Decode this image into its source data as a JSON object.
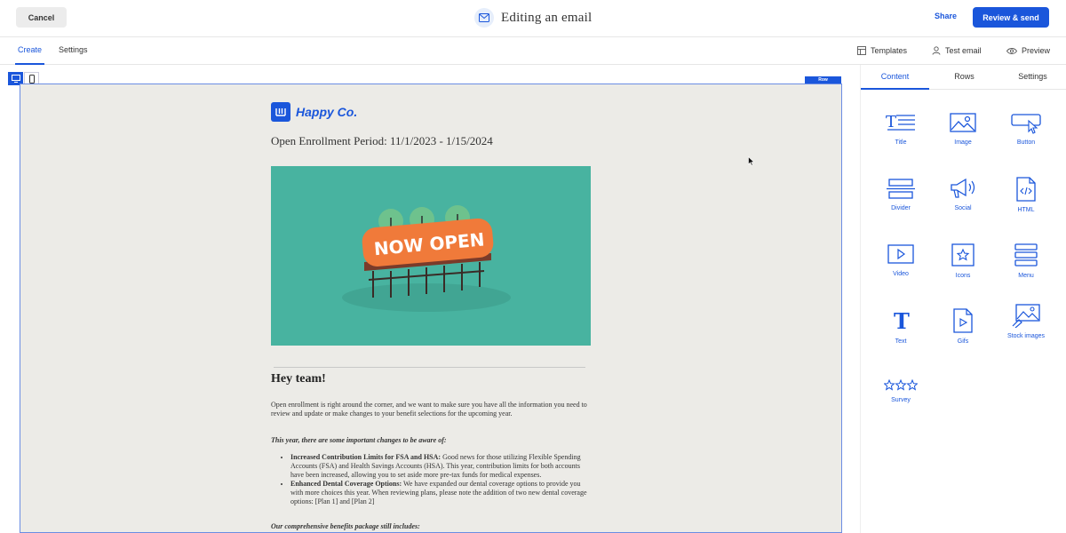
{
  "header": {
    "cancel_label": "Cancel",
    "title": "Editing an email",
    "share_label": "Share",
    "review_label": "Review & send"
  },
  "subbar": {
    "tabs": [
      {
        "label": "Create",
        "active": true
      },
      {
        "label": "Settings",
        "active": false
      }
    ],
    "tools": {
      "templates": "Templates",
      "test_email": "Test email",
      "preview": "Preview"
    }
  },
  "canvas": {
    "row_tag": "Row"
  },
  "email": {
    "logo_text": "Happy Co.",
    "enrollment_title": "Open Enrollment Period: 11/1/2023 - 1/15/2024",
    "hero_sign_text": "NOW OPEN",
    "greeting": "Hey team!",
    "intro": "Open enrollment is right around the corner, and we want to make sure you have all the information you need to review and update or make changes to your benefit selections for the upcoming year.",
    "changes_heading": "This year, there are some important changes to be aware of:",
    "changes": [
      {
        "title": "Increased Contribution Limits for FSA and HSA:",
        "text": " Good news for those utilizing Flexible Spending Accounts (FSA) and Health Savings Accounts (HSA). This year, contribution limits for both accounts have been increased, allowing you to set aside more pre-tax funds for medical expenses."
      },
      {
        "title": "Enhanced Dental Coverage Options:",
        "text": " We have expanded our dental coverage options to provide you with more choices this year. When reviewing plans, please note the addition of two new dental coverage options: [Plan 1] and [Plan 2]"
      }
    ],
    "package_heading": "Our comprehensive benefits package still includes:"
  },
  "panel": {
    "tabs": [
      {
        "label": "Content",
        "active": true
      },
      {
        "label": "Rows",
        "active": false
      },
      {
        "label": "Settings",
        "active": false
      }
    ],
    "blocks": [
      {
        "label": "Title",
        "icon": "title-icon"
      },
      {
        "label": "Image",
        "icon": "image-icon"
      },
      {
        "label": "Button",
        "icon": "button-icon"
      },
      {
        "label": "Divider",
        "icon": "divider-icon"
      },
      {
        "label": "Social",
        "icon": "megaphone-icon"
      },
      {
        "label": "HTML",
        "icon": "html-icon"
      },
      {
        "label": "Video",
        "icon": "video-icon"
      },
      {
        "label": "Icons",
        "icon": "star-icon"
      },
      {
        "label": "Menu",
        "icon": "menu-icon"
      },
      {
        "label": "Text",
        "icon": "text-icon"
      },
      {
        "label": "Gifs",
        "icon": "gif-icon"
      },
      {
        "label": "Stock images",
        "icon": "stock-images-icon"
      },
      {
        "label": "Survey",
        "icon": "survey-icon"
      }
    ]
  },
  "colors": {
    "accent": "#1a56db",
    "canvas_bg": "#ecebe7",
    "hero_bg": "#48b3a0",
    "sign_orange": "#f07a3a"
  }
}
